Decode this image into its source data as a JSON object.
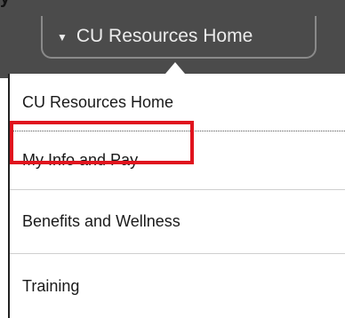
{
  "header": {
    "clipped_text": "y",
    "dropdown_label": "CU Resources Home"
  },
  "menu": {
    "items": [
      {
        "label": "CU Resources Home"
      },
      {
        "label": "My Info and Pay"
      },
      {
        "label": "Benefits and Wellness"
      },
      {
        "label": "Training"
      }
    ]
  },
  "colors": {
    "header_bg": "#4b4b4b",
    "highlight": "#e0141e"
  }
}
